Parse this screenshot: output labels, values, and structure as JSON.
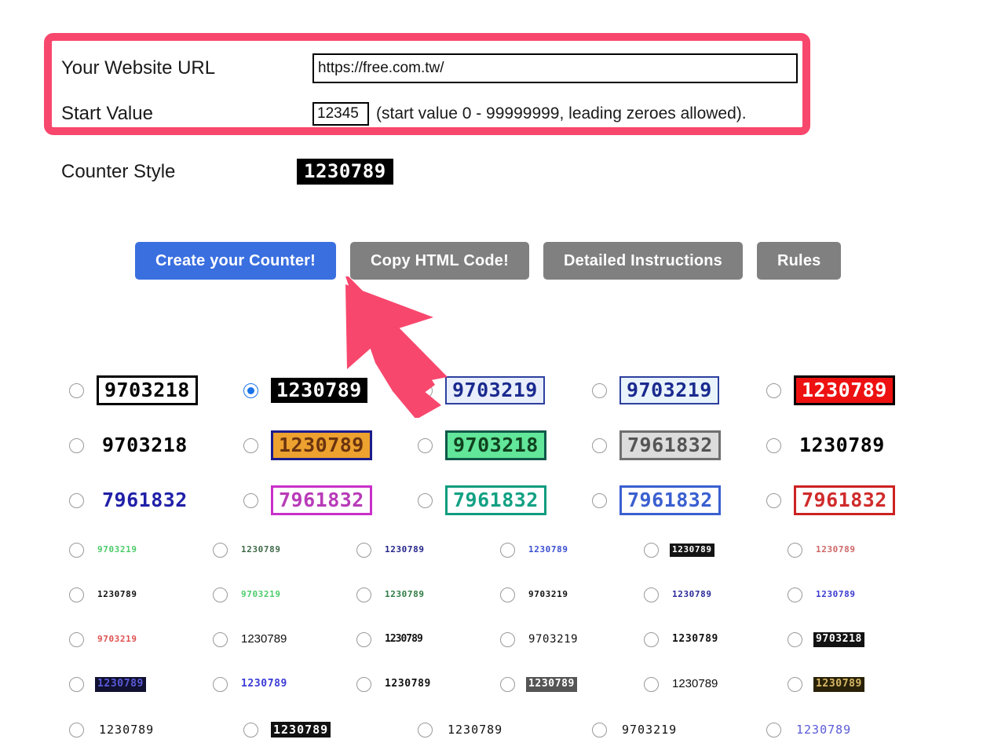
{
  "form": {
    "url_label": "Your Website URL",
    "url_value": "https://free.com.tw/",
    "url_placeholder": "https://",
    "start_label": "Start Value",
    "start_value": "12345",
    "start_placeholder": "0",
    "start_hint": "(start value 0 - 99999999, leading zeroes allowed).",
    "counter_style_label": "Counter Style",
    "counter_style_preview": "1230789"
  },
  "buttons": {
    "create": "Create your Counter!",
    "copy": "Copy HTML Code!",
    "instructions": "Detailed Instructions",
    "rules": "Rules"
  },
  "colors": {
    "highlight": "#f8476d",
    "arrow": "#f8476d",
    "primary_button": "#3a6fe0",
    "grey_button": "#808080",
    "radio_selected": "#1a73e8"
  },
  "styles": {
    "big_rows": [
      [
        {
          "text": "9703218",
          "selected": false,
          "fg": "#000000",
          "bg": "#ffffff",
          "border": "3px solid #000000"
        },
        {
          "text": "1230789",
          "selected": true,
          "fg": "#ffffff",
          "bg": "#000000",
          "border": "none"
        },
        {
          "text": "9703219",
          "selected": false,
          "fg": "#1a2a8f",
          "bg": "#e8eefb",
          "border": "2px solid #2c3f9e"
        },
        {
          "text": "9703219",
          "selected": false,
          "fg": "#1a2a8f",
          "bg": "#e9f3fb",
          "border": "2px solid #2c3f9e"
        },
        {
          "text": "1230789",
          "selected": false,
          "fg": "#ffffff",
          "bg": "#ee1111",
          "border": "3px solid #000000"
        }
      ],
      [
        {
          "text": "9703218",
          "selected": false,
          "fg": "#000000",
          "bg": "transparent",
          "border": "none"
        },
        {
          "text": "1230789",
          "selected": false,
          "fg": "#6b3410",
          "bg": "#eda12f",
          "border": "3px solid #1c1c8c"
        },
        {
          "text": "9703218",
          "selected": false,
          "fg": "#10421f",
          "bg": "#62e69a",
          "border": "3px solid #10584a"
        },
        {
          "text": "7961832",
          "selected": false,
          "fg": "#555555",
          "bg": "#dcdcdc",
          "border": "3px solid #6f6f6f"
        },
        {
          "text": "1230789",
          "selected": false,
          "fg": "#000000",
          "bg": "transparent",
          "border": "none"
        }
      ],
      [
        {
          "text": "7961832",
          "selected": false,
          "fg": "#2020a8",
          "bg": "transparent",
          "border": "none"
        },
        {
          "text": "7961832",
          "selected": false,
          "fg": "#b83bb8",
          "bg": "#ffffff",
          "border": "3px solid #c930c9"
        },
        {
          "text": "7961832",
          "selected": false,
          "fg": "#12a183",
          "bg": "#ffffff",
          "border": "3px solid #0f9c7e"
        },
        {
          "text": "7961832",
          "selected": false,
          "fg": "#3a5fd0",
          "bg": "#ffffff",
          "border": "3px solid #3a5fd0"
        },
        {
          "text": "7961832",
          "selected": false,
          "fg": "#d02b2b",
          "bg": "#ffffff",
          "border": "3px solid #cc2222"
        }
      ]
    ],
    "small_rows": [
      [
        {
          "text": "9703219",
          "selected": false,
          "fg": "#4ccc6a",
          "bg": "transparent",
          "border": "none"
        },
        {
          "text": "1230789",
          "selected": false,
          "fg": "#3f6b4a",
          "bg": "transparent",
          "border": "none"
        },
        {
          "text": "1230789",
          "selected": false,
          "fg": "#24248a",
          "bg": "transparent",
          "border": "none"
        },
        {
          "text": "1230789",
          "selected": false,
          "fg": "#3a4fd0",
          "bg": "transparent",
          "border": "none"
        },
        {
          "text": "1230789",
          "selected": false,
          "fg": "#ffffff",
          "bg": "#141414",
          "border": "none"
        },
        {
          "text": "1230789",
          "selected": false,
          "fg": "#cf6666",
          "bg": "transparent",
          "border": "none"
        }
      ],
      [
        {
          "text": "1230789",
          "selected": false,
          "fg": "#111111",
          "bg": "transparent",
          "border": "none"
        },
        {
          "text": "9703219",
          "selected": false,
          "fg": "#4ccc6a",
          "bg": "transparent",
          "border": "none"
        },
        {
          "text": "1230789",
          "selected": false,
          "fg": "#2f7a42",
          "bg": "transparent",
          "border": "none"
        },
        {
          "text": "9703219",
          "selected": false,
          "fg": "#111111",
          "bg": "transparent",
          "border": "none"
        },
        {
          "text": "1230789",
          "selected": false,
          "fg": "#2a2a9a",
          "bg": "transparent",
          "border": "none"
        },
        {
          "text": "1230789",
          "selected": false,
          "fg": "#3a3ad0",
          "bg": "transparent",
          "border": "none"
        }
      ],
      [
        {
          "text": "9703219",
          "selected": false,
          "fg": "#e05050",
          "bg": "transparent",
          "border": "none"
        },
        {
          "text": "1230789",
          "selected": false,
          "fg": "#111111",
          "bg": "transparent",
          "border": "none"
        },
        {
          "text": "1230789",
          "selected": false,
          "fg": "#111111",
          "bg": "transparent",
          "border": "none"
        },
        {
          "text": "9703219",
          "selected": false,
          "fg": "#111111",
          "bg": "transparent",
          "border": "none"
        },
        {
          "text": "1230789",
          "selected": false,
          "fg": "#111111",
          "bg": "transparent",
          "border": "none"
        },
        {
          "text": "9703218",
          "selected": false,
          "fg": "#ffffff",
          "bg": "#121212",
          "border": "none"
        }
      ],
      [
        {
          "text": "1230789",
          "selected": false,
          "fg": "#5a5ad8",
          "bg": "#101030",
          "border": "none"
        },
        {
          "text": "1230789",
          "selected": false,
          "fg": "#3a3ad8",
          "bg": "transparent",
          "border": "none"
        },
        {
          "text": "1230789",
          "selected": false,
          "fg": "#111111",
          "bg": "transparent",
          "border": "none"
        },
        {
          "text": "1230789",
          "selected": false,
          "fg": "#ffffff",
          "bg": "#555555",
          "border": "none"
        },
        {
          "text": "1230789",
          "selected": false,
          "fg": "#111111",
          "bg": "transparent",
          "border": "none"
        },
        {
          "text": "1230789",
          "selected": false,
          "fg": "#d8b868",
          "bg": "#2a2208",
          "border": "none"
        }
      ]
    ],
    "last_row": [
      {
        "text": "1230789",
        "selected": false,
        "fg": "#111111",
        "bg": "transparent",
        "border": "none"
      },
      {
        "text": "1230789",
        "selected": false,
        "fg": "#ffffff",
        "bg": "#111111",
        "border": "none"
      },
      {
        "text": "1230789",
        "selected": false,
        "fg": "#111111",
        "bg": "transparent",
        "border": "none"
      },
      {
        "text": "9703219",
        "selected": false,
        "fg": "#111111",
        "bg": "transparent",
        "border": "none"
      },
      {
        "text": "1230789",
        "selected": false,
        "fg": "#5a5ad8",
        "bg": "transparent",
        "border": "none"
      }
    ]
  }
}
